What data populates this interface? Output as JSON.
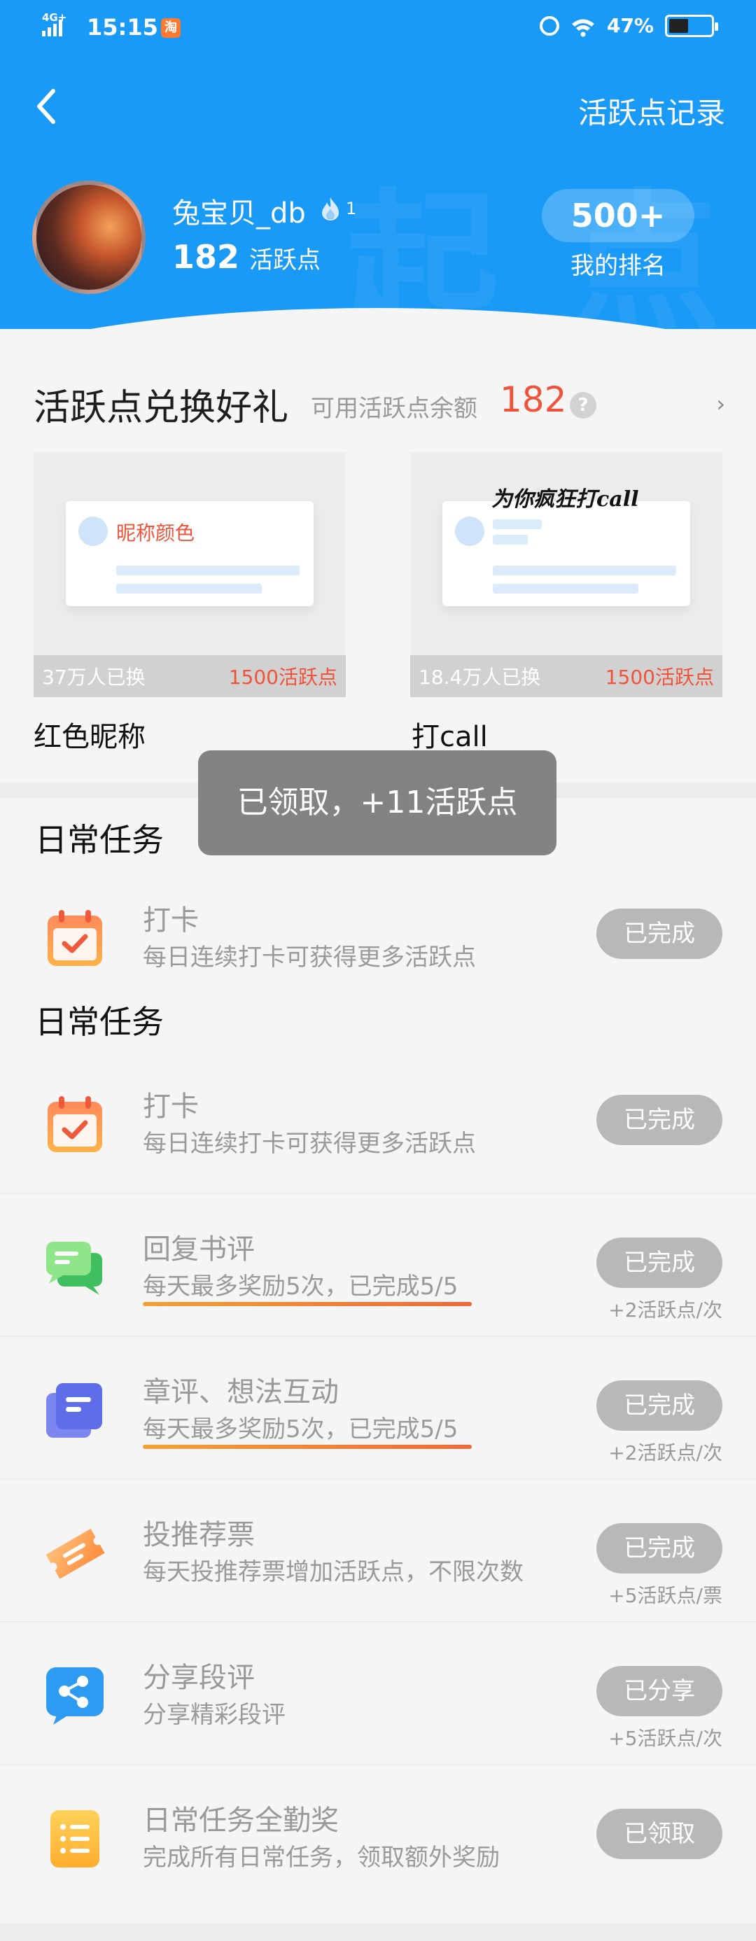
{
  "status_bar": {
    "network": "4G+",
    "time": "15:15",
    "app_badge": "淘",
    "battery_percent": "47%",
    "battery_level": 0.47
  },
  "nav": {
    "back_icon": "chevron-left-icon",
    "right_link": "活跃点记录"
  },
  "profile": {
    "username": "兔宝贝_db",
    "level": "1",
    "points": "182",
    "points_unit": "活跃点",
    "rank_value": "500+",
    "rank_label": "我的排名"
  },
  "exchange": {
    "title": "活跃点兑换好礼",
    "balance_label": "可用活跃点余额",
    "balance": "182",
    "help_icon": "?",
    "arrow": "›",
    "cards": [
      {
        "preview_text": "昵称颜色",
        "count": "37万人已换",
        "price": "1500活跃点",
        "name": "红色昵称"
      },
      {
        "preview_text": "为你疯狂打call",
        "count": "18.4万人已换",
        "price": "1500活跃点",
        "name": "打call"
      }
    ]
  },
  "tasks": {
    "section_title": "日常任务",
    "section_title_repeat": "日常任务",
    "items": [
      {
        "name": "打卡",
        "desc": "每日连续打卡可获得更多活跃点",
        "button": "已完成",
        "reward": ""
      },
      {
        "name": "打卡",
        "desc": "每日连续打卡可获得更多活跃点",
        "button": "已完成",
        "reward": ""
      },
      {
        "name": "回复书评",
        "desc": "每天最多奖励5次，已完成5/5",
        "button": "已完成",
        "reward": "+2活跃点/次"
      },
      {
        "name": "章评、想法互动",
        "desc": "每天最多奖励5次，已完成5/5",
        "button": "已完成",
        "reward": "+2活跃点/次"
      },
      {
        "name": "投推荐票",
        "desc": "每天投推荐票增加活跃点，不限次数",
        "button": "已完成",
        "reward": "+5活跃点/票"
      },
      {
        "name": "分享段评",
        "desc": "分享精彩段评",
        "button": "已分享",
        "reward": "+5活跃点/次"
      },
      {
        "name": "日常任务全勤奖",
        "desc": "完成所有日常任务，领取额外奖励",
        "button": "已领取",
        "reward": ""
      }
    ]
  },
  "toast": {
    "text": "已领取，+11活跃点"
  },
  "colors": {
    "header_blue": "#1a9af7",
    "accent_red": "#f0533a",
    "button_gray": "#b8b8b8"
  }
}
